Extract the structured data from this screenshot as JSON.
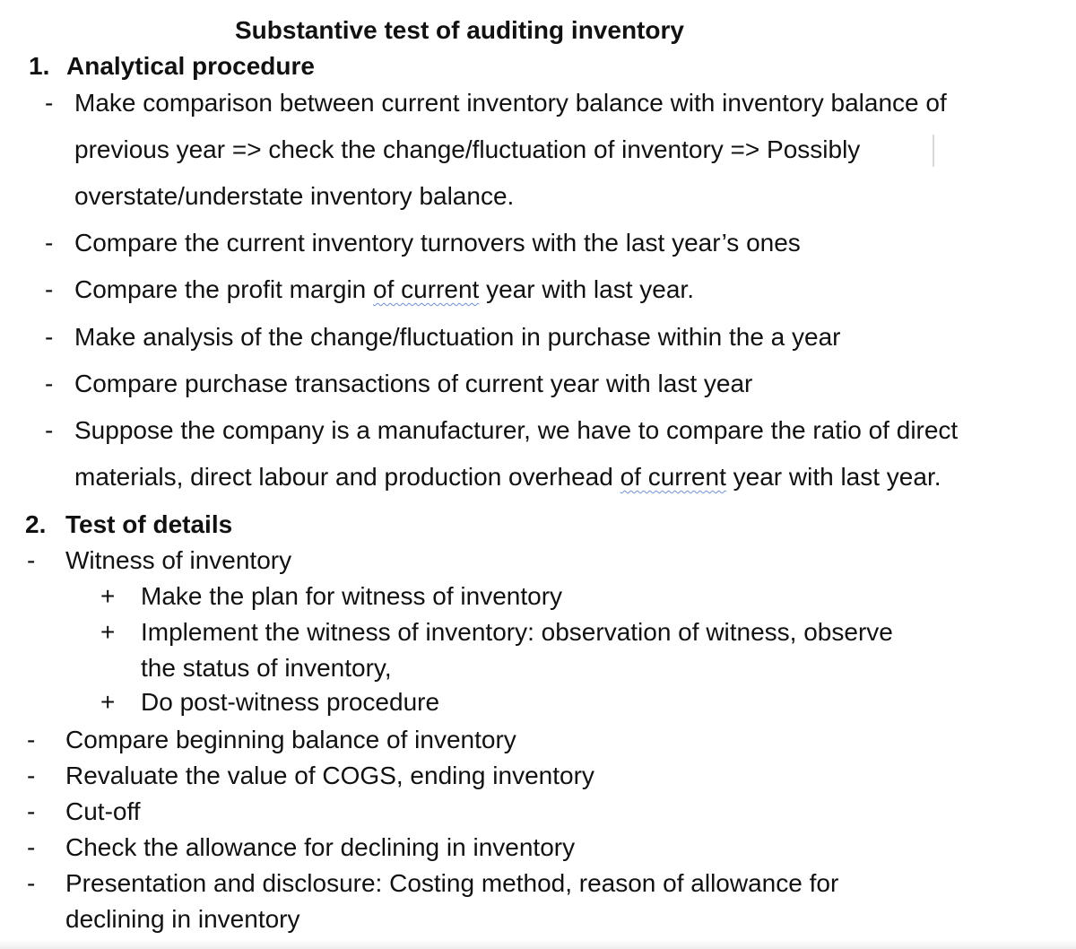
{
  "document": {
    "title": "Substantive test of auditing inventory",
    "sections": [
      {
        "number": "1.",
        "heading": "Analytical procedure",
        "items": [
          {
            "bullet": "-",
            "lines": [
              "Make comparison between current inventory balance with inventory balance of",
              "previous year => check the change/fluctuation of inventory => Possibly",
              "overstate/understate inventory balance."
            ]
          },
          {
            "bullet": "-",
            "lines": [
              "Compare the current inventory turnovers with the last year’s ones"
            ]
          },
          {
            "bullet": "-",
            "pre": "Compare the profit margin ",
            "flagged": "of current",
            "post": " year with last year."
          },
          {
            "bullet": "-",
            "lines": [
              "Make analysis of the change/fluctuation in purchase within the a year"
            ]
          },
          {
            "bullet": "-",
            "lines": [
              "Compare purchase transactions of current year with last year"
            ]
          },
          {
            "bullet": "-",
            "line1": "Suppose the company is a manufacturer, we have to compare the ratio of direct",
            "line2_pre": "materials, direct labour and production overhead ",
            "line2_flagged": "of current",
            "line2_post": " year with last year."
          }
        ]
      },
      {
        "number": "2.",
        "heading": "Test of details",
        "items": [
          {
            "bullet": "-",
            "text": "Witness of inventory",
            "subitems": [
              {
                "bullet": "+",
                "lines": [
                  "Make the plan for witness of inventory"
                ]
              },
              {
                "bullet": "+",
                "lines": [
                  "Implement the witness of inventory: observation of witness, observe",
                  "the status of inventory,"
                ]
              },
              {
                "bullet": "+",
                "lines": [
                  "Do post-witness procedure"
                ]
              }
            ]
          },
          {
            "bullet": "-",
            "text": "Compare beginning balance of inventory"
          },
          {
            "bullet": "-",
            "text": "Revaluate the value of COGS, ending inventory"
          },
          {
            "bullet": "-",
            "text": "Cut-off"
          },
          {
            "bullet": "-",
            "text": "Check the allowance for declining in inventory"
          },
          {
            "bullet": "-",
            "lines": [
              "Presentation and disclosure: Costing method, reason of allowance for",
              "declining in inventory"
            ]
          }
        ]
      }
    ]
  }
}
